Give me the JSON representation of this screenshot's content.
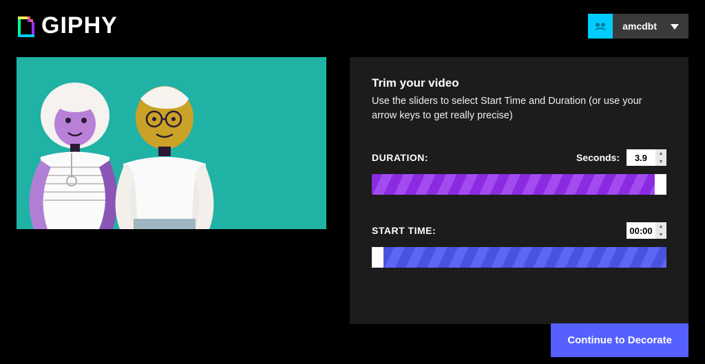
{
  "brand": {
    "name": "GIPHY"
  },
  "user": {
    "name": "amcdbt"
  },
  "panel": {
    "title": "Trim your video",
    "description": "Use the sliders to select Start Time and Duration (or use your arrow keys to get really precise)"
  },
  "duration": {
    "label": "DURATION:",
    "unit": "Seconds:",
    "value": "3.9",
    "fill_percent": 96
  },
  "startTime": {
    "label": "START TIME:",
    "value": "00:00",
    "fill_left_percent": 4
  },
  "cta": {
    "label": "Continue to Decorate"
  }
}
